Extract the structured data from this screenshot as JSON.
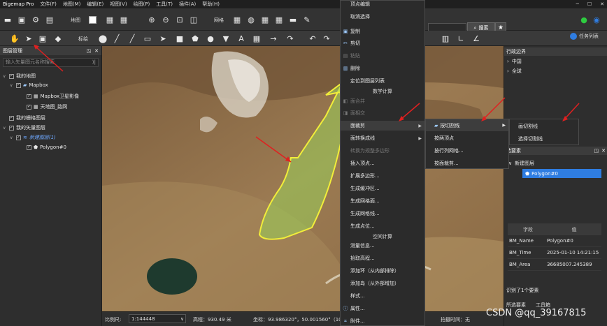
{
  "app": {
    "title": "Bigemap Pro"
  },
  "menu": [
    "文件(F)",
    "地图(M)",
    "编辑(E)",
    "视图(V)",
    "绘图(P)",
    "工具(T)",
    "插件(A)",
    "帮助(H)"
  ],
  "toolbar": {
    "map_label": "地图",
    "grid_label": "网格",
    "edit_label": "标绘",
    "search_label": "搜索",
    "task_list_label": "任务列表"
  },
  "left_panel": {
    "title": "图层管理",
    "search_placeholder": "输入矢量图元名称搜索",
    "tree": {
      "my_map": "我的地图",
      "mapbox": "Mapbox",
      "mapbox_sat": "Mapbox卫星影像",
      "tianditu_road": "天地图_路网",
      "my_raster": "我的栅格图层",
      "my_vector": "我的矢量图层",
      "new_layer": "新建图层(1)",
      "polygon": "Polygon#0"
    }
  },
  "context_menu": {
    "items": {
      "vertex_edit": "顶点编辑",
      "cancel_select": "取消选择",
      "copy": "复制",
      "cut": "剪切",
      "paste": "粘贴",
      "delete": "删除",
      "locate_in_layers": "定位到图层列表",
      "section_math": "数学计算",
      "merge": "面合并",
      "intersect": "面相交",
      "clip": "面裁剪",
      "to_line": "面转换成线",
      "to_regular": "转换为规整多边形",
      "insert_vertex": "插入顶点...",
      "expand_polygon": "扩展多边形...",
      "buffer": "生成缓冲区...",
      "grid_surface": "生成网格面...",
      "grid_line": "生成网格线...",
      "points": "生成点位...",
      "section_spatial": "空间计算",
      "measure": "测量信息...",
      "elevation": "拾取高程...",
      "add_ring": "添加环（从内部排除）",
      "add_island": "添加岛（从外部增加）",
      "style": "样式...",
      "properties": "属性...",
      "attachment": "附件..."
    }
  },
  "submenu1": {
    "by_cut_line": "按切割线",
    "by_two_vertices": "按两顶点",
    "by_row_col_grid": "按行列网格...",
    "by_surface": "按面裁剪..."
  },
  "submenu2": {
    "draw_cut_line": "画切割线",
    "select_cut_line": "选择切割线"
  },
  "right_panel": {
    "admin_title": "行政边界",
    "admin_items": [
      "中国",
      "全球"
    ],
    "selection_title": "选要素",
    "selection_layer": "新建图层",
    "selection_item": "Polygon#0",
    "attr_headers": [
      "字段",
      "值"
    ],
    "attrs": [
      {
        "field": "BM_Name",
        "value": "Polygon#0"
      },
      {
        "field": "BM_Time",
        "value": "2025-01-10 14:21:15"
      },
      {
        "field": "BM_Area",
        "value": "36685007.245389"
      }
    ],
    "identified": "识别了1个要素",
    "tabs": [
      "所选要素",
      "工具箱"
    ]
  },
  "status": {
    "scale_label": "比例尺:",
    "scale_value": "1:144448",
    "elevation": "高程：930.49 米",
    "coords": "坐标：93.986320°，50.001560°（10",
    "capture_time": "拍摄时间：无"
  },
  "watermark": "CSDN @qq_39167815",
  "colors": {
    "accent": "#2f7de1",
    "polygon_fill": "#9ad25a",
    "polygon_outline": "#f2ee3a",
    "arrow": "#e02020"
  }
}
